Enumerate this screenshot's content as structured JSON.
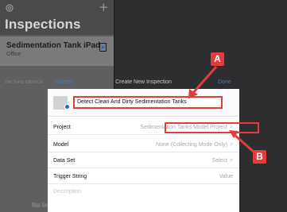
{
  "sidebar": {
    "title": "Inspections",
    "document": {
      "title": "Sedimentation Tank iPad",
      "subtitle": "Office"
    },
    "section_label": "ON THIS DEVICE",
    "empty_text": "No In"
  },
  "modal": {
    "header": {
      "cancel_label": "Cancel",
      "title": "Create New Inspection",
      "done_label": "Done"
    },
    "name_value": "Detect Clean And Dirty Sedimentation Tanks",
    "rows": [
      {
        "label": "Project",
        "value": "Sedimentation Tanks Model Project",
        "chevron": ">"
      },
      {
        "label": "Model",
        "value": "None (Collecting Mode Only)",
        "chevron": ">"
      },
      {
        "label": "Data Set",
        "value": "Select",
        "chevron": ">"
      },
      {
        "label": "Trigger String",
        "value": "Value",
        "chevron": ""
      }
    ],
    "description_placeholder": "Description"
  },
  "callouts": {
    "a": "A",
    "b": "B"
  },
  "colors": {
    "callout": "#e43b3b",
    "accent": "#2a64c8",
    "link": "#4a7aaa"
  },
  "icons": [
    "gear-icon",
    "plus-icon",
    "document-icon",
    "chevron-right-icon"
  ]
}
